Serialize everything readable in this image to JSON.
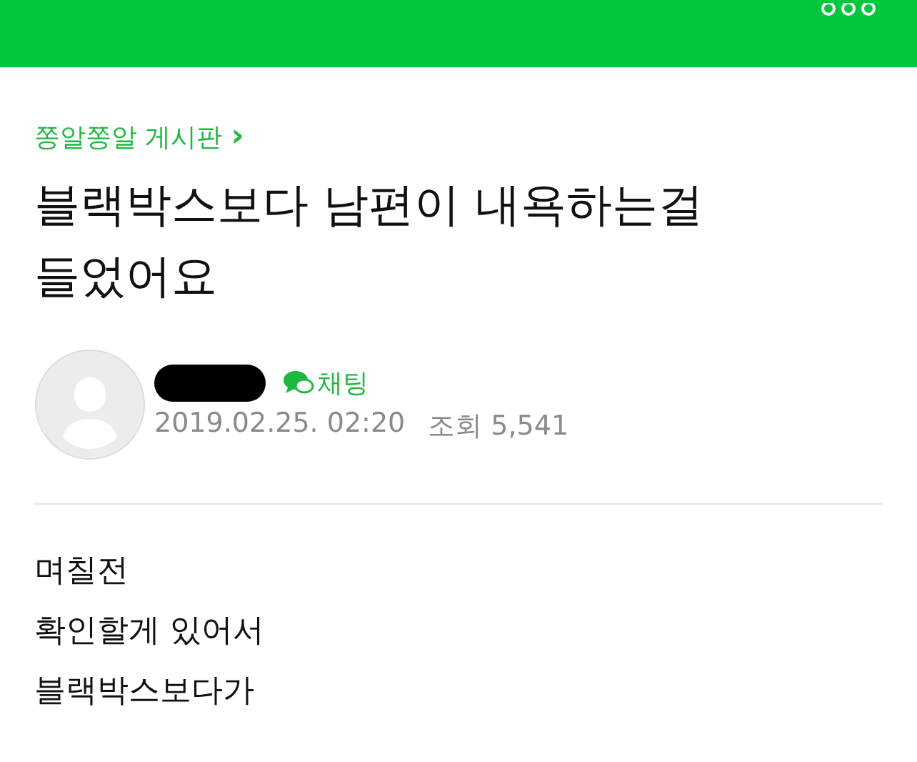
{
  "board": {
    "label": "쫑알쫑알 게시판",
    "chevron": "›"
  },
  "post": {
    "title": "블랙박스보다 남편이 내욕하는걸 들었어요",
    "author": {
      "redacted": true,
      "chat_label": "채팅"
    },
    "date": "2019.02.25. 02:20",
    "views": "조회 5,541",
    "body": [
      "며칠전",
      "확인할게 있어서",
      "블랙박스보다가"
    ]
  }
}
